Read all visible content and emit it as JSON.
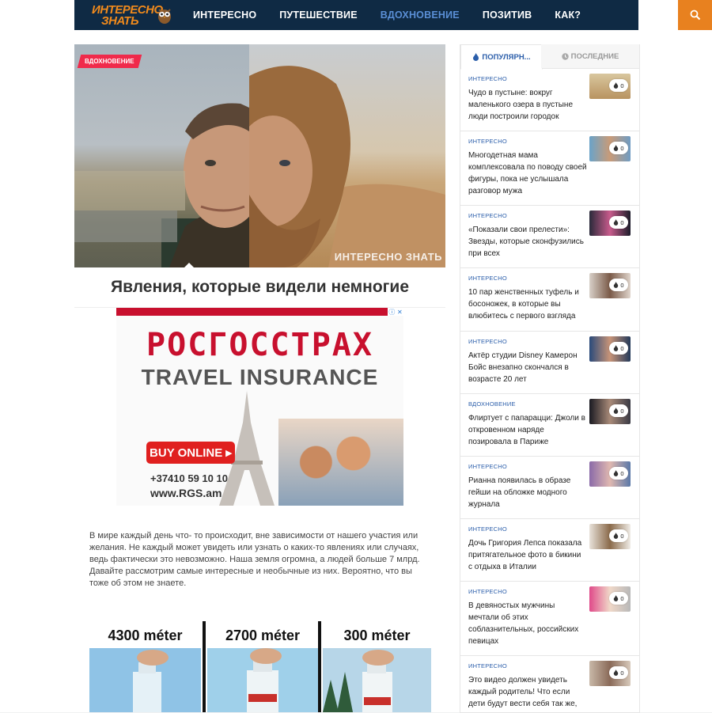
{
  "header": {
    "logo_line1": "ИНТЕРЕСНО",
    "logo_line2": "ЗНАТЬ",
    "nav": [
      "ИНТЕРЕСНО",
      "ПУТЕШЕСТВИЕ",
      "ВДОХНОВЕНИЕ",
      "ПОЗИТИВ",
      "КАК?"
    ],
    "active_nav": "ВДОХНОВЕНИЕ",
    "search_icon": "search-icon",
    "accent_color": "#e8811f",
    "bar_color": "#0f2a44"
  },
  "article": {
    "category_badge": "ВДОХНОВЕНИЕ",
    "watermark": "ИНТЕРЕСНО ЗНАТЬ",
    "title": "Явления, которые видели немногие",
    "intro": "В мире каждый день что- то происходит, вне зависимости от нашего участия или желания. Не каждый может увидеть или узнать о каких-то явлениях или случаях, ведь фактически это невозможно. Наша земля огромна, а людей больше 7 млрд. Давайте рассмотрим самые интересные и необычные из них. Вероятно, что вы тоже об этом не знаете.",
    "bottle_labels": [
      "4300 méter",
      "2700 méter",
      "300 méter"
    ]
  },
  "ad": {
    "brand": "РОСГОССТРАХ",
    "headline": "TRAVEL INSURANCE",
    "button": "BUY ONLINE",
    "phone": "+37410 59 10 10",
    "site": "www.RGS.am"
  },
  "sidebar": {
    "tab_popular": "ПОПУЛЯРН...",
    "tab_latest": "ПОСЛЕДНИЕ",
    "items": [
      {
        "category": "ИНТЕРЕСНО",
        "title": "Чудо в пустыне: вокруг маленького озера в пустыне люди построили городок",
        "count": "0"
      },
      {
        "category": "ИНТЕРЕСНО",
        "title": "Многодетная мама комплексовала по поводу своей фигуры, пока не услышала разговор мужа",
        "count": "0"
      },
      {
        "category": "ИНТЕРЕСНО",
        "title": "«Показали свои прелести»: Звезды, которые сконфузились при всех",
        "count": "0"
      },
      {
        "category": "ИНТЕРЕСНО",
        "title": "10 пар женственных туфель и босоножек, в которые вы влюбитесь с первого взгляда",
        "count": "0"
      },
      {
        "category": "ИНТЕРЕСНО",
        "title": "Актёр студии Disney Камерон Бойс внезапно скончался в возрасте 20 лет",
        "count": "0"
      },
      {
        "category": "ВДОХНОВЕНИЕ",
        "title": "Флиртует с папарацци: Джоли в откровенном наряде позировала в Париже",
        "count": "0"
      },
      {
        "category": "ИНТЕРЕСНО",
        "title": "Рианна появилась в образе гейши на обложке модного журнала",
        "count": "0"
      },
      {
        "category": "ИНТЕРЕСНО",
        "title": "Дочь Григория Лепса показала притягательное фото в бикини с отдыха в Италии",
        "count": "0"
      },
      {
        "category": "ИНТЕРЕСНО",
        "title": "В девяностых мужчины мечтали об этих соблазнительных, российских певицах",
        "count": "0"
      },
      {
        "category": "ИНТЕРЕСНО",
        "title": "Это видео должен увидеть каждый родитель! Что если дети будут вести себя так же,",
        "count": "0"
      }
    ]
  }
}
